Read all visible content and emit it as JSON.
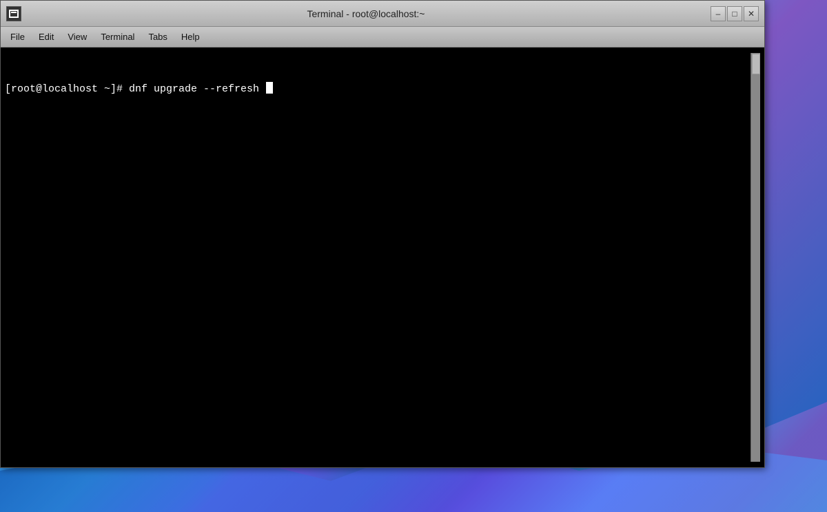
{
  "window": {
    "title": "Terminal - root@localhost:~",
    "icon_label": "terminal-icon"
  },
  "titlebar": {
    "minimize_label": "–",
    "maximize_label": "□",
    "close_label": "✕"
  },
  "menubar": {
    "items": [
      {
        "label": "File",
        "id": "file"
      },
      {
        "label": "Edit",
        "id": "edit"
      },
      {
        "label": "View",
        "id": "view"
      },
      {
        "label": "Terminal",
        "id": "terminal"
      },
      {
        "label": "Tabs",
        "id": "tabs"
      },
      {
        "label": "Help",
        "id": "help"
      }
    ]
  },
  "terminal": {
    "prompt": "[root@localhost ~]# ",
    "command": "dnf upgrade --refresh "
  }
}
